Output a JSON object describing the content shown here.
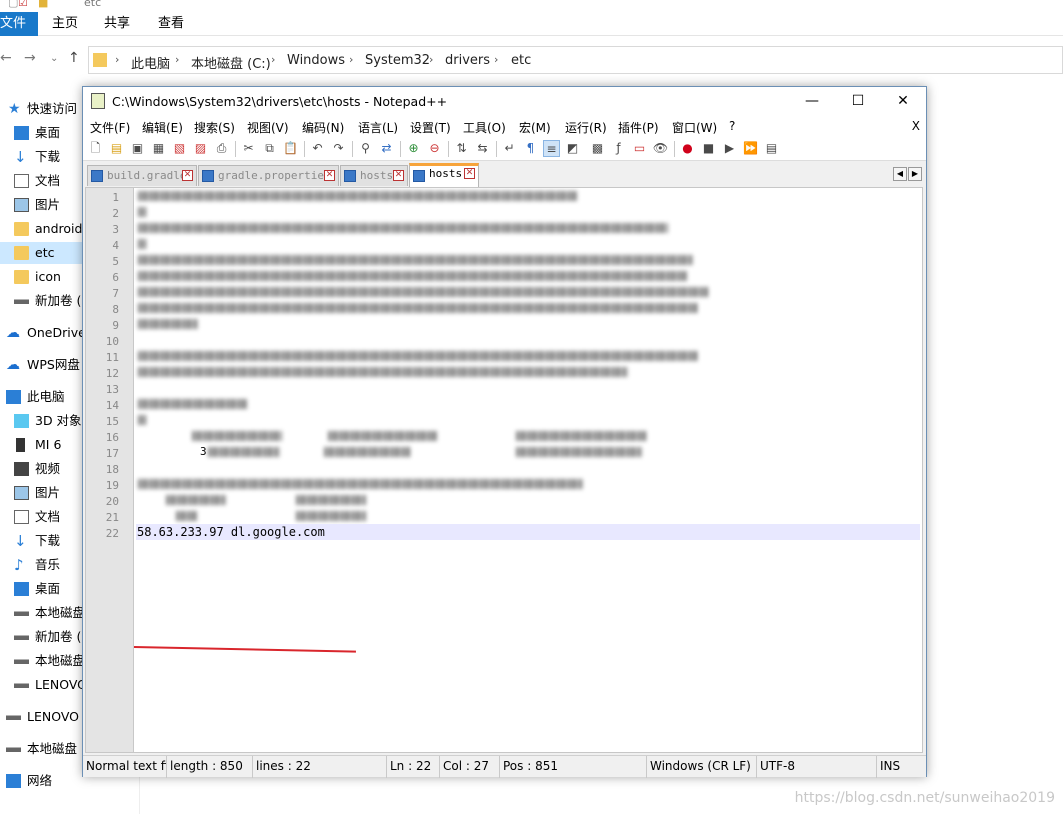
{
  "explorer": {
    "title": "etc",
    "ribbon_tabs": [
      "文件",
      "主页",
      "共享",
      "查看"
    ],
    "breadcrumb": [
      "此电脑",
      "本地磁盘 (C:)",
      "Windows",
      "System32",
      "drivers",
      "etc"
    ],
    "nav_items": [
      {
        "label": "快速访问",
        "icon": "star-icon"
      },
      {
        "label": "桌面",
        "icon": "desktop-icon"
      },
      {
        "label": "下载",
        "icon": "download-icon"
      },
      {
        "label": "文档",
        "icon": "document-icon"
      },
      {
        "label": "图片",
        "icon": "picture-icon"
      },
      {
        "label": "android",
        "icon": "folder-icon"
      },
      {
        "label": "etc",
        "icon": "folder-icon"
      },
      {
        "label": "icon",
        "icon": "folder-icon"
      },
      {
        "label": "新加卷 (I",
        "icon": "drive-icon"
      },
      {
        "label": "OneDrive",
        "icon": "cloud-icon"
      },
      {
        "label": "WPS网盘",
        "icon": "cloud-icon"
      },
      {
        "label": "此电脑",
        "icon": "computer-icon"
      },
      {
        "label": "3D 对象",
        "icon": "cube-icon"
      },
      {
        "label": "MI 6",
        "icon": "phone-icon"
      },
      {
        "label": "视频",
        "icon": "video-icon"
      },
      {
        "label": "图片",
        "icon": "picture-icon"
      },
      {
        "label": "文档",
        "icon": "document-icon"
      },
      {
        "label": "下载",
        "icon": "download-icon"
      },
      {
        "label": "音乐",
        "icon": "music-icon"
      },
      {
        "label": "桌面",
        "icon": "desktop-icon"
      },
      {
        "label": "本地磁盘",
        "icon": "drive-icon"
      },
      {
        "label": "新加卷 (I",
        "icon": "drive-icon"
      },
      {
        "label": "本地磁盘",
        "icon": "drive-icon"
      },
      {
        "label": "LENOVO",
        "icon": "drive-icon"
      },
      {
        "label": "LENOVO",
        "icon": "drive-icon"
      },
      {
        "label": "本地磁盘",
        "icon": "drive-icon"
      },
      {
        "label": "网络",
        "icon": "network-icon"
      }
    ]
  },
  "npp": {
    "title": "C:\\Windows\\System32\\drivers\\etc\\hosts - Notepad++",
    "controls": {
      "minimize": "—",
      "maximize": "☐",
      "close": "✕"
    },
    "menus": [
      "文件(F)",
      "编辑(E)",
      "搜索(S)",
      "视图(V)",
      "编码(N)",
      "语言(L)",
      "设置(T)",
      "工具(O)",
      "宏(M)",
      "运行(R)",
      "插件(P)",
      "窗口(W)",
      "?"
    ],
    "menu_close": "X",
    "tabs": [
      {
        "label": "build.gradle",
        "active": false
      },
      {
        "label": "gradle.properties",
        "active": false
      },
      {
        "label": "hosts",
        "active": false
      },
      {
        "label": "hosts",
        "active": true
      }
    ],
    "line_numbers": [
      "1",
      "2",
      "3",
      "4",
      "5",
      "6",
      "7",
      "8",
      "9",
      "10",
      "11",
      "12",
      "13",
      "14",
      "15",
      "16",
      "17",
      "18",
      "19",
      "20",
      "21",
      "22"
    ],
    "current_line_text": "58.63.233.97 dl.google.com",
    "line17_fragment": "3",
    "status": {
      "type": "Normal text fi",
      "length": "length : 850",
      "lines": "lines : 22",
      "ln": "Ln : 22",
      "col": "Col : 27",
      "pos": "Pos : 851",
      "eol": "Windows (CR LF)",
      "encoding": "UTF-8",
      "mode": "INS"
    }
  },
  "watermark": "https://blog.csdn.net/sunweihao2019",
  "colors": {
    "accent": "#1979ca",
    "tab_active_top": "#f7a43b",
    "underline": "#d9262c",
    "current_line": "#e8e8ff"
  }
}
